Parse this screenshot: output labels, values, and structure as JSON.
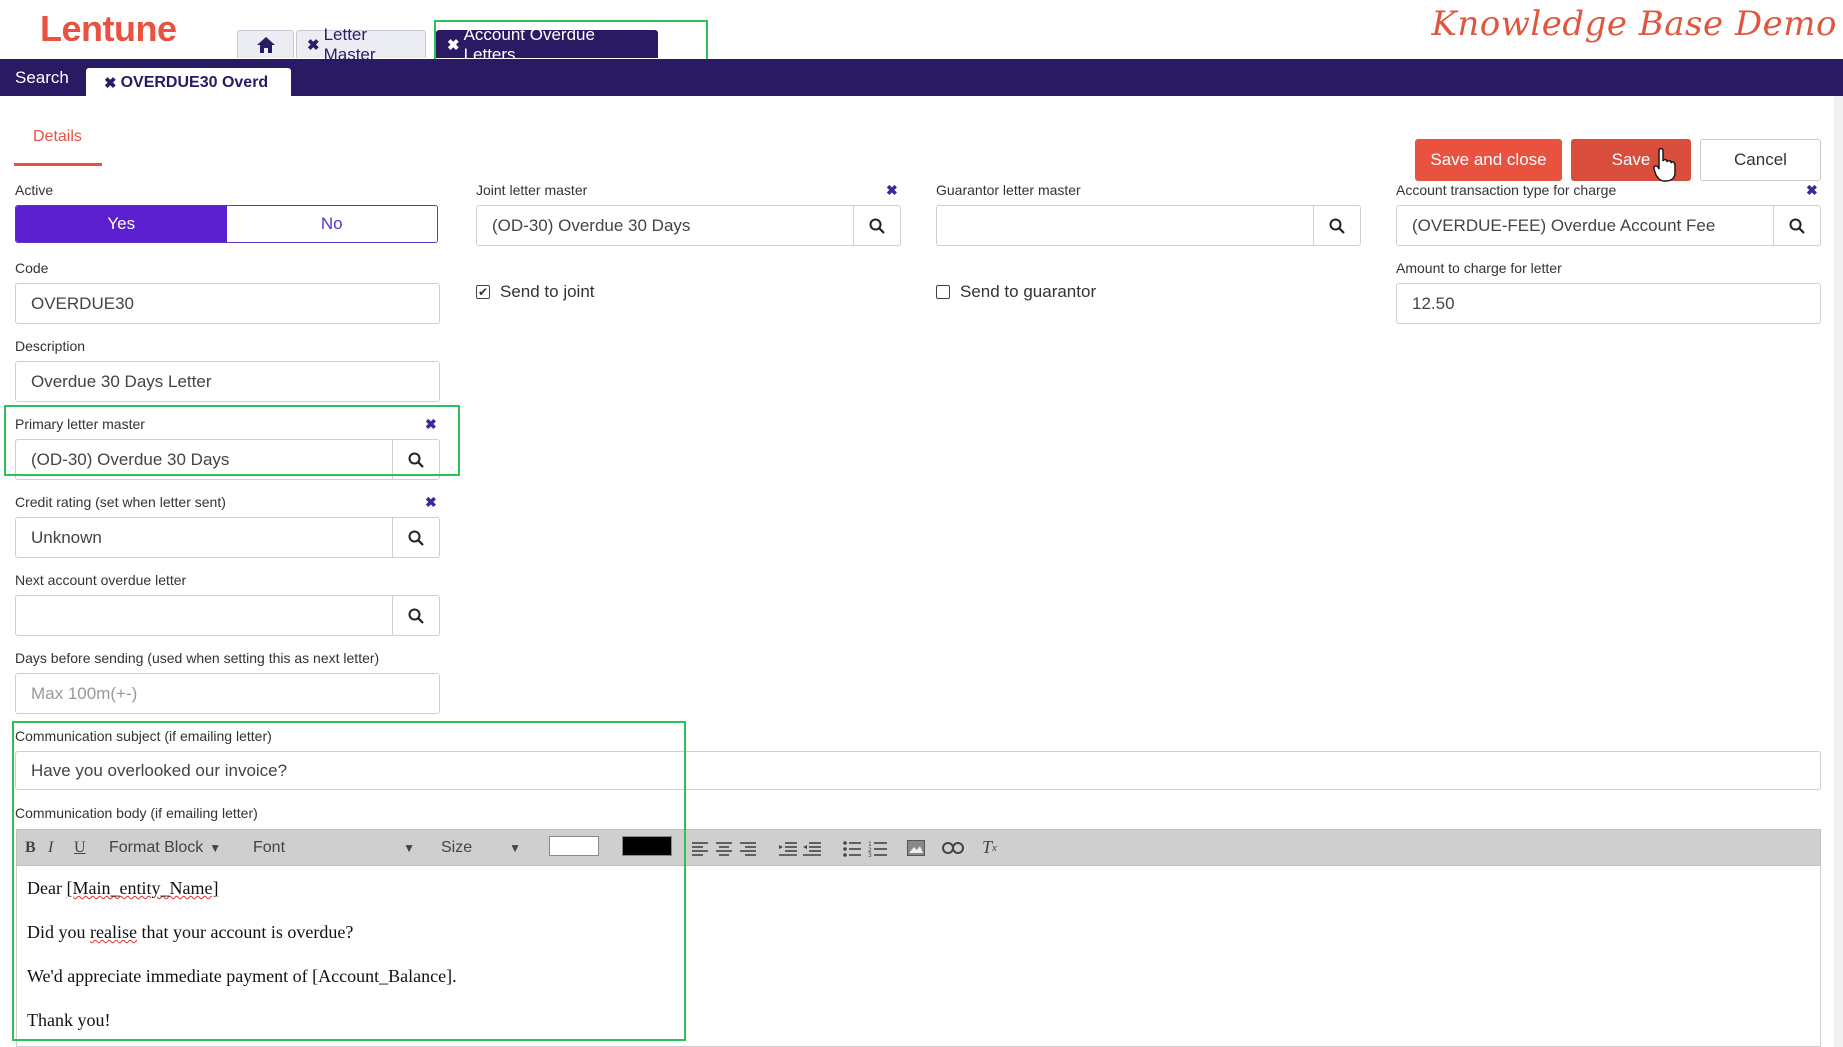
{
  "brand": {
    "logo": "Lentune",
    "kb_title": "Knowledge Base Demo"
  },
  "top_tabs": [
    {
      "label": "Letter Master"
    },
    {
      "label": "Account Overdue Letters"
    }
  ],
  "nav": {
    "search": "Search",
    "record_tab": "OVERDUE30 Overd"
  },
  "page": {
    "details_tab": "Details"
  },
  "actions": {
    "save_close": "Save and close",
    "save": "Save",
    "cancel": "Cancel"
  },
  "form": {
    "active": {
      "label": "Active",
      "yes": "Yes",
      "no": "No",
      "selected": "Yes"
    },
    "code": {
      "label": "Code",
      "value": "OVERDUE30"
    },
    "description": {
      "label": "Description",
      "value": "Overdue 30 Days Letter"
    },
    "primary_letter": {
      "label": "Primary letter master",
      "value": "(OD-30) Overdue 30 Days"
    },
    "credit_rating": {
      "label": "Credit rating (set when letter sent)",
      "value": "Unknown"
    },
    "next_letter": {
      "label": "Next account overdue letter",
      "value": ""
    },
    "days_before": {
      "label": "Days before sending (used when setting this as next letter)",
      "placeholder": "Max 100m(+-)"
    },
    "joint_letter": {
      "label": "Joint letter master",
      "value": "(OD-30) Overdue 30 Days"
    },
    "send_to_joint": {
      "label": "Send to joint",
      "checked": true
    },
    "guarantor_letter": {
      "label": "Guarantor letter master",
      "value": ""
    },
    "send_to_guarantor": {
      "label": "Send to guarantor",
      "checked": false
    },
    "transaction_type": {
      "label": "Account transaction type for charge",
      "value": "(OVERDUE-FEE) Overdue Account Fee"
    },
    "amount": {
      "label": "Amount to charge for letter",
      "value": "12.50"
    },
    "subject": {
      "label": "Communication subject (if emailing letter)",
      "value": "Have you overlooked our invoice?"
    },
    "body": {
      "label": "Communication body (if emailing letter)"
    }
  },
  "editor": {
    "format_block": "Format Block",
    "font": "Font",
    "size": "Size",
    "fg_color": "#ffffff",
    "bg_color": "#000000",
    "lines": {
      "l1a": "Dear ",
      "l1b": "[Main_entity_Name]",
      "l2a": "Did you ",
      "l2b": "realise",
      "l2c": " that your account is overdue?",
      "l3": "We'd appreciate immediate payment of [Account_Balance].",
      "l4": "Thank you!"
    }
  },
  "colors": {
    "brand": "#e8523f",
    "nav": "#2a1a63",
    "toggle_on": "#5b1fd0",
    "highlight": "#2fbf5a"
  }
}
